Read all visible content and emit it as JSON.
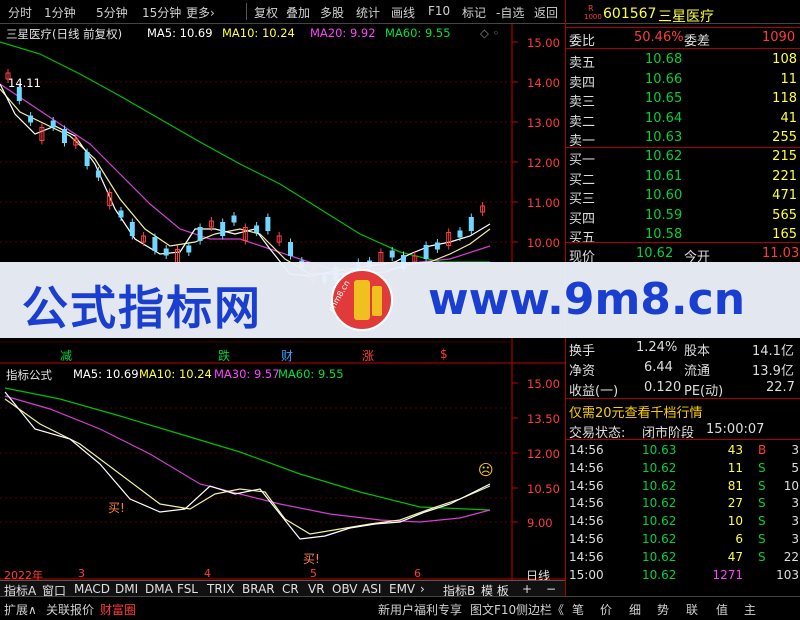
{
  "toolbar": {
    "items": [
      "分时",
      "1分钟",
      "5分钟",
      "15分钟",
      "更多›",
      "复权",
      "叠加",
      "多股",
      "统计",
      "画线",
      "F10",
      "标记",
      "-自选",
      "返回"
    ]
  },
  "main_chart": {
    "legend_name": "三星医疗(日线 前复权)",
    "ma5": "MA5: 10.69",
    "ma10": "MA10: 10.24",
    "ma20": "MA20: 9.92",
    "ma60": "MA60: 9.55",
    "max_label": "14.11",
    "yticks": [
      "15.00",
      "14.00",
      "13.00",
      "12.00",
      "11.00",
      "10.00"
    ],
    "markers": [
      "减",
      "跌",
      "财",
      "涨",
      "$"
    ]
  },
  "indicator_chart": {
    "legend_name": "指标公式",
    "ma5": "MA5: 10.69",
    "ma10": "MA10: 10.24",
    "ma30": "MA30: 9.57",
    "ma60": "MA60: 9.55",
    "yticks": [
      "15.00",
      "13.50",
      "12.00",
      "10.50",
      "9.00"
    ],
    "buy1": "买!",
    "buy2": "买!"
  },
  "xaxis": {
    "labels": [
      "2022年",
      "3",
      "4",
      "5",
      "6"
    ],
    "right_label": "日线"
  },
  "tabs": [
    "指标A",
    "窗口",
    "MACD",
    "DMI",
    "DMA",
    "FSL",
    "TRIX",
    "BRAR",
    "CR",
    "VR",
    "OBV",
    "ASI",
    "EMV",
    "›",
    "指标B",
    "模 板",
    "+",
    "−"
  ],
  "bottom": {
    "left": [
      "扩展∧",
      "关联报价",
      "财富圈"
    ],
    "center": "新用户福利专享",
    "mid": "图文F10",
    "mid2": "侧边栏《",
    "right": [
      "笔",
      "价",
      "细",
      "势",
      "联",
      "值",
      "主"
    ]
  },
  "quote": {
    "badge_top": "R",
    "badge_bottom": "1000",
    "code": "601567",
    "name": "三星医疗",
    "weibi_label": "委比",
    "weibi": "50.46%",
    "weicha_label": "委差",
    "weicha": "1090",
    "asks": [
      {
        "l": "卖五",
        "p": "10.68",
        "v": "108"
      },
      {
        "l": "卖四",
        "p": "10.66",
        "v": "11"
      },
      {
        "l": "卖三",
        "p": "10.65",
        "v": "118"
      },
      {
        "l": "卖二",
        "p": "10.64",
        "v": "41"
      },
      {
        "l": "卖一",
        "p": "10.63",
        "v": "255"
      }
    ],
    "bids": [
      {
        "l": "买一",
        "p": "10.62",
        "v": "215"
      },
      {
        "l": "买二",
        "p": "10.61",
        "v": "221"
      },
      {
        "l": "买三",
        "p": "10.60",
        "v": "471"
      },
      {
        "l": "买四",
        "p": "10.59",
        "v": "565"
      },
      {
        "l": "买五",
        "p": "10.58",
        "v": "165"
      }
    ],
    "xianjia_l": "现价",
    "xianjia": "10.62",
    "jinkai_l": "今开",
    "jinkai": "11.03",
    "huanshou_l": "换手",
    "huanshou": "1.24%",
    "guben_l": "股本",
    "guben": "14.1亿",
    "jingzi_l": "净资",
    "jingzi": "6.44",
    "liutong_l": "流通",
    "liutong": "13.9亿",
    "shouyi_l": "收益(一)",
    "shouyi": "0.120",
    "pe_l": "PE(动)",
    "pe": "22.7",
    "promo": "仅需20元查看千档行情",
    "status_l": "交易状态:",
    "status": "闭市阶段",
    "status_time": "15:00:07",
    "ticks": [
      {
        "t": "14:56",
        "p": "10.63",
        "v": "43",
        "s": "B",
        "n": "3"
      },
      {
        "t": "14:56",
        "p": "10.62",
        "v": "11",
        "s": "S",
        "n": "5"
      },
      {
        "t": "14:56",
        "p": "10.62",
        "v": "81",
        "s": "S",
        "n": "10"
      },
      {
        "t": "14:56",
        "p": "10.62",
        "v": "27",
        "s": "S",
        "n": "3"
      },
      {
        "t": "14:56",
        "p": "10.62",
        "v": "10",
        "s": "S",
        "n": "3"
      },
      {
        "t": "14:56",
        "p": "10.62",
        "v": "6",
        "s": "S",
        "n": "3"
      },
      {
        "t": "14:56",
        "p": "10.62",
        "v": "47",
        "s": "S",
        "n": "22"
      },
      {
        "t": "15:00",
        "p": "10.62",
        "v": "1271",
        "s": "",
        "n": "103"
      }
    ]
  },
  "watermark": {
    "left": "公式指标网",
    "right": "www.9m8.cn",
    "logo": "chm8.cn"
  },
  "colors": {
    "red": "#ff3b3b",
    "green": "#00d040",
    "yellow": "#ffff00",
    "magenta": "#ff40ff",
    "axis_red": "#c00000"
  }
}
